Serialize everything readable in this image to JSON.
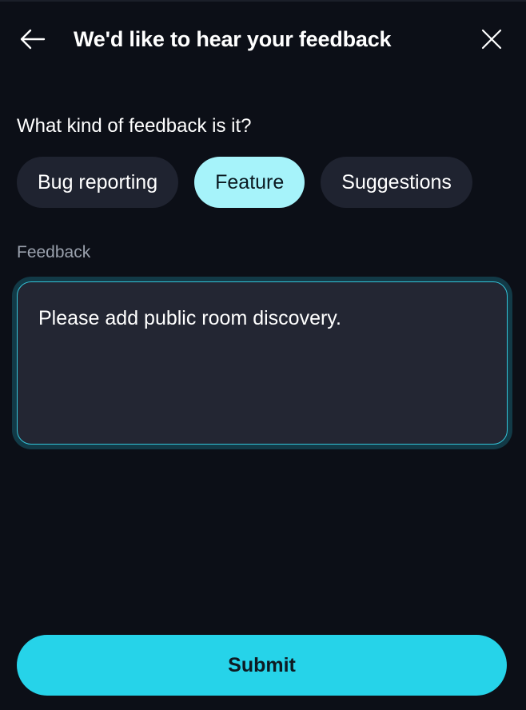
{
  "header": {
    "title": "We'd like to hear your feedback",
    "back_icon": "arrow-left-icon",
    "close_icon": "close-icon"
  },
  "feedback_type": {
    "question": "What kind of feedback is it?",
    "options": [
      {
        "label": "Bug reporting",
        "selected": false
      },
      {
        "label": "Feature",
        "selected": true
      },
      {
        "label": "Suggestions",
        "selected": false
      }
    ]
  },
  "feedback_field": {
    "label": "Feedback",
    "value": "Please add public room discovery."
  },
  "submit": {
    "label": "Submit"
  },
  "colors": {
    "background": "#0c0f17",
    "chip": "#1f2330",
    "chip_selected": "#a6f3fa",
    "accent": "#26d3e9",
    "focus_ring": "#34c4d9"
  }
}
